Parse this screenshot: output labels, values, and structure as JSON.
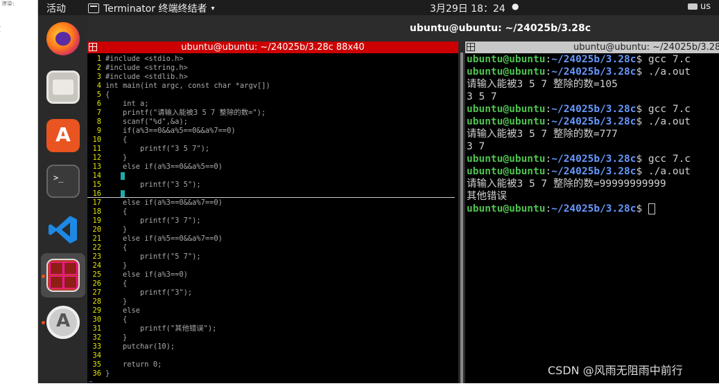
{
  "leftstrip": {
    "top_text": "渲染:",
    "mark": "6",
    "side_mark": "["
  },
  "topbar": {
    "activities": "活动",
    "app_name": "Terminator 终端终结者",
    "app_arrow": "▾",
    "clock": "3月29日  18：24",
    "dot": "●",
    "lang": "us"
  },
  "window": {
    "title": "ubuntu@ubuntu: ~/24025b/3.28c",
    "left_pane_title": "ubuntu@ubuntu: ~/24025b/3.28c 88x40",
    "right_pane_title": "ubuntu@ubuntu: ~/24025b/3.28c"
  },
  "editor": {
    "lines": [
      {
        "n": "1",
        "t": "#include <stdio.h>"
      },
      {
        "n": "2",
        "t": "#include <string.h>"
      },
      {
        "n": "3",
        "t": "#include <stdlib.h>"
      },
      {
        "n": "4",
        "t": "int main(int argc, const char *argv[])"
      },
      {
        "n": "5",
        "t": "{"
      },
      {
        "n": "6",
        "t": "    int a;"
      },
      {
        "n": "7",
        "t": "    printf(\"请输入能被3 5 7 整除的数=\");"
      },
      {
        "n": "8",
        "t": "    scanf(\"%d\",&a);"
      },
      {
        "n": "9",
        "t": "    if(a%3==0&&a%5==0&&a%7==0)"
      },
      {
        "n": "10",
        "t": "    {"
      },
      {
        "n": "11",
        "t": "        printf(\"3 5 7\");"
      },
      {
        "n": "12",
        "t": "    }"
      },
      {
        "n": "13",
        "t": "    else if(a%3==0&&a%5==0)"
      },
      {
        "n": "14",
        "t": "    "
      },
      {
        "n": "15",
        "t": "        printf(\"3 5\");"
      },
      {
        "n": "16",
        "t": "    "
      },
      {
        "n": "17",
        "t": "    else if(a%3==0&&a%7==0)"
      },
      {
        "n": "18",
        "t": "    {"
      },
      {
        "n": "19",
        "t": "        printf(\"3 7\");"
      },
      {
        "n": "20",
        "t": "    }"
      },
      {
        "n": "21",
        "t": "    else if(a%5==0&&a%7==0)"
      },
      {
        "n": "22",
        "t": "    {"
      },
      {
        "n": "23",
        "t": "        printf(\"5 7\");"
      },
      {
        "n": "24",
        "t": "    }"
      },
      {
        "n": "25",
        "t": "    else if(a%3==0)"
      },
      {
        "n": "26",
        "t": "    {"
      },
      {
        "n": "27",
        "t": "        printf(\"3\");"
      },
      {
        "n": "28",
        "t": "    }"
      },
      {
        "n": "29",
        "t": "    else"
      },
      {
        "n": "30",
        "t": "    {"
      },
      {
        "n": "31",
        "t": "        printf(\"其他错误\");"
      },
      {
        "n": "32",
        "t": "    }"
      },
      {
        "n": "33",
        "t": "    putchar(10);"
      },
      {
        "n": "34",
        "t": ""
      },
      {
        "n": "35",
        "t": "    return 0;"
      },
      {
        "n": "36",
        "t": "}"
      }
    ],
    "tilde": "~"
  },
  "terminal": {
    "user": "ubuntu@ubuntu",
    "path": "~/24025b/3.28c",
    "lines": [
      {
        "type": "prompt",
        "cmd": " gcc 7.c"
      },
      {
        "type": "prompt",
        "cmd": " ./a.out"
      },
      {
        "type": "out",
        "text": "请输入能被3 5 7 整除的数=105"
      },
      {
        "type": "out",
        "text": "3 5 7"
      },
      {
        "type": "prompt",
        "cmd": " gcc 7.c"
      },
      {
        "type": "prompt",
        "cmd": " ./a.out"
      },
      {
        "type": "out",
        "text": "请输入能被3 5 7 整除的数=777"
      },
      {
        "type": "out",
        "text": "3 7"
      },
      {
        "type": "prompt",
        "cmd": " gcc 7.c"
      },
      {
        "type": "prompt",
        "cmd": " ./a.out"
      },
      {
        "type": "out",
        "text": "请输入能被3 5 7 整除的数=99999999999"
      },
      {
        "type": "out",
        "text": "其他错误"
      },
      {
        "type": "prompt",
        "cmd": " "
      }
    ]
  },
  "watermark": "CSDN @风雨无阻雨中前行",
  "dock": {
    "items": [
      "firefox-icon",
      "files-icon",
      "app-store-icon",
      "terminal-icon",
      "vscode-icon",
      "terminator-icon",
      "software-updater-icon"
    ],
    "store_glyph": "A",
    "terminal_glyph": ">_",
    "updater_glyph": "A"
  }
}
